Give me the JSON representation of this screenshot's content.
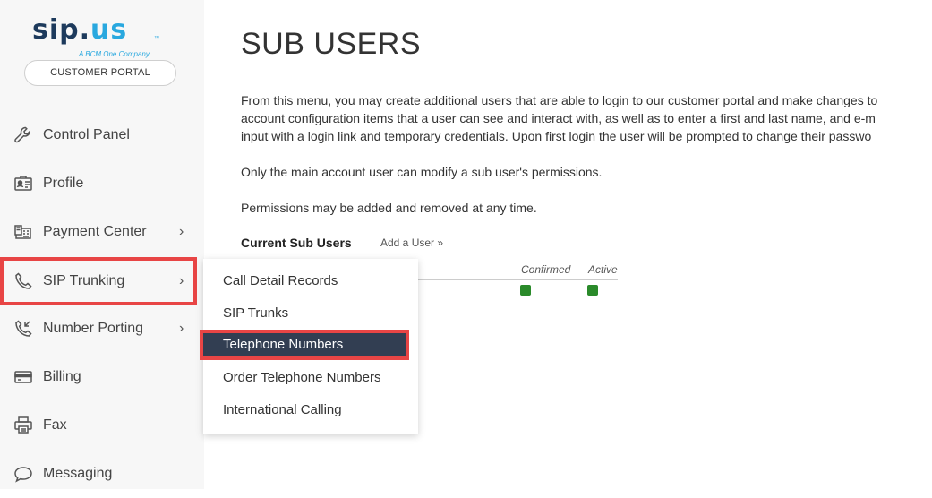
{
  "logo": {
    "sip": "sip",
    "dot": ".",
    "us": "us",
    "tm": "™",
    "tagline": "A BCM One Company"
  },
  "portal_button": "CUSTOMER PORTAL",
  "sidebar": {
    "items": [
      {
        "label": "Control Panel",
        "icon": "wrench-icon"
      },
      {
        "label": "Profile",
        "icon": "id-card-icon"
      },
      {
        "label": "Payment Center",
        "icon": "cash-register-icon",
        "chevron": "›"
      },
      {
        "label": "SIP Trunking",
        "icon": "phone-icon",
        "chevron": "›"
      },
      {
        "label": "Number Porting",
        "icon": "phone-porting-icon",
        "chevron": "›"
      },
      {
        "label": "Billing",
        "icon": "credit-card-icon"
      },
      {
        "label": "Fax",
        "icon": "printer-icon"
      },
      {
        "label": "Messaging",
        "icon": "chat-bubble-icon"
      }
    ]
  },
  "main": {
    "title": "SUB USERS",
    "paragraph1_line1": "From this menu, you may create additional users that are able to login to our customer portal and make changes to",
    "paragraph1_line2": "account configuration items that a user can see and interact with, as well as to enter a first and last name, and e-m",
    "paragraph1_line3": "input with a login link and temporary credentials. Upon first login the user will be prompted to change their passwo",
    "paragraph2": "Only the main account user can modify a sub user's permissions.",
    "paragraph3": "Permissions may be added and removed at any time.",
    "current_sub_users": "Current Sub Users",
    "add_user": "Add a User »",
    "columns": {
      "confirmed": "Confirmed",
      "active": "Active"
    }
  },
  "flyout": {
    "items": [
      "Call Detail Records",
      "SIP Trunks",
      "Telephone Numbers",
      "Order Telephone Numbers",
      "International Calling"
    ]
  },
  "colors": {
    "highlight_border": "#e84545",
    "selected_bg": "#323e52",
    "status_green": "#2a8a2a",
    "brand_dark": "#1d3a5c",
    "brand_light": "#29a8df"
  }
}
